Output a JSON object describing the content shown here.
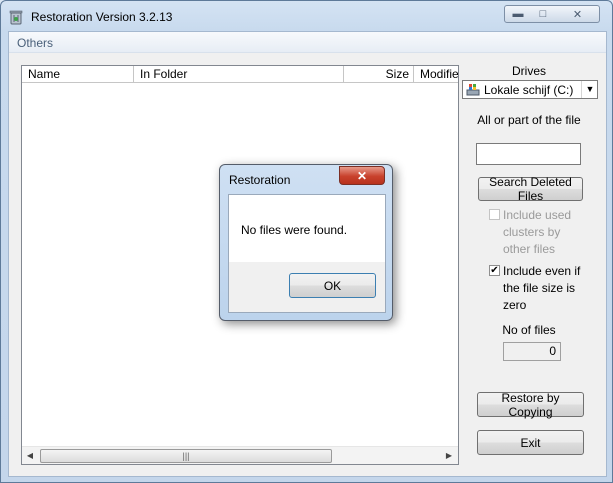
{
  "window": {
    "title": "Restoration Version 3.2.13"
  },
  "menu": {
    "others": "Others"
  },
  "list": {
    "columns": [
      "Name",
      "In Folder",
      "Size",
      "Modified"
    ]
  },
  "panel": {
    "drives_label": "Drives",
    "drive_value": "Lokale schijf (C:)",
    "file_label": "All or part of the file",
    "file_value": "",
    "search_button": "Search Deleted Files",
    "include_used_label": "Include used clusters by other files",
    "include_used_checked": false,
    "include_zero_label": "Include even if the file size is zero",
    "include_zero_checked": true,
    "no_of_files_label": "No of files",
    "no_of_files_value": "0",
    "restore_button": "Restore by Copying",
    "exit_button": "Exit"
  },
  "dialog": {
    "title": "Restoration",
    "message": "No files were found.",
    "ok_button": "OK"
  },
  "colors": {
    "frame": "#d4e3f3",
    "dialog_close": "#c8412c",
    "ok_border": "#3c7fb1"
  }
}
